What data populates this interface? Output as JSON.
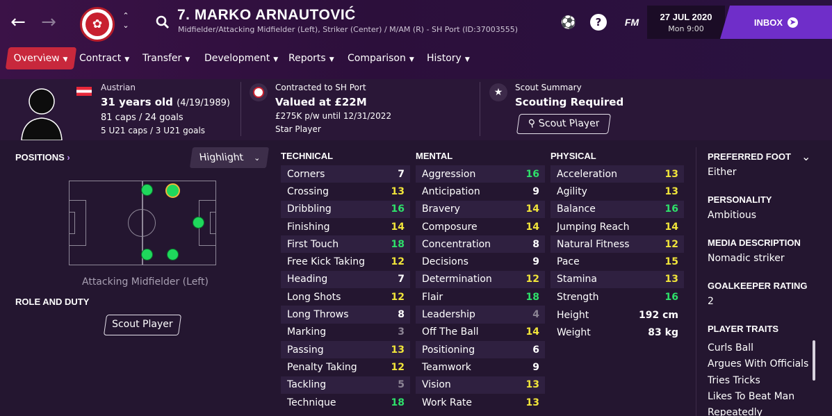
{
  "header": {
    "player_title": "7. MARKO ARNAUTOVIĆ",
    "player_subtitle": "Midfielder/Attacking Midfielder (Left), Striker (Center) / M/AM (R) - SH Port (ID:37003555)",
    "date": "27 JUL 2020",
    "time": "Mon 9:00",
    "inbox_label": "INBOX",
    "fm_label": "FM",
    "help_label": "?"
  },
  "tabs": [
    {
      "label": "Overview"
    },
    {
      "label": "Contract"
    },
    {
      "label": "Transfer"
    },
    {
      "label": "Development"
    },
    {
      "label": "Reports"
    },
    {
      "label": "Comparison"
    },
    {
      "label": "History"
    }
  ],
  "info": {
    "nationality": "Austrian",
    "age": "31 years old",
    "dob": "(4/19/1989)",
    "caps": "81 caps / 24 goals",
    "u21": "5 U21 caps / 3 U21 goals",
    "contract_label": "Contracted to SH Port",
    "value": "Valued at £22M",
    "wage": "£275K p/w until 12/31/2022",
    "status": "Star Player",
    "scout_label": "Scout Summary",
    "scout_status": "Scouting Required",
    "scout_button": "Scout Player"
  },
  "positions": {
    "title": "POSITIONS",
    "highlight": "Highlight",
    "position_name": "Attacking Midfielder (Left)",
    "role_title": "ROLE AND DUTY",
    "role_button": "Scout Player"
  },
  "attributes": {
    "technical_title": "TECHNICAL",
    "mental_title": "MENTAL",
    "physical_title": "PHYSICAL",
    "technical": [
      {
        "name": "Corners",
        "value": "7",
        "tier": "w"
      },
      {
        "name": "Crossing",
        "value": "13",
        "tier": "y"
      },
      {
        "name": "Dribbling",
        "value": "16",
        "tier": "g"
      },
      {
        "name": "Finishing",
        "value": "14",
        "tier": "y"
      },
      {
        "name": "First Touch",
        "value": "18",
        "tier": "g"
      },
      {
        "name": "Free Kick Taking",
        "value": "12",
        "tier": "y"
      },
      {
        "name": "Heading",
        "value": "7",
        "tier": "w"
      },
      {
        "name": "Long Shots",
        "value": "12",
        "tier": "y"
      },
      {
        "name": "Long Throws",
        "value": "8",
        "tier": "w"
      },
      {
        "name": "Marking",
        "value": "3",
        "tier": "d"
      },
      {
        "name": "Passing",
        "value": "13",
        "tier": "y"
      },
      {
        "name": "Penalty Taking",
        "value": "12",
        "tier": "y"
      },
      {
        "name": "Tackling",
        "value": "5",
        "tier": "d"
      },
      {
        "name": "Technique",
        "value": "18",
        "tier": "g"
      }
    ],
    "mental": [
      {
        "name": "Aggression",
        "value": "16",
        "tier": "g"
      },
      {
        "name": "Anticipation",
        "value": "9",
        "tier": "w"
      },
      {
        "name": "Bravery",
        "value": "14",
        "tier": "y"
      },
      {
        "name": "Composure",
        "value": "14",
        "tier": "y"
      },
      {
        "name": "Concentration",
        "value": "8",
        "tier": "w"
      },
      {
        "name": "Decisions",
        "value": "9",
        "tier": "w"
      },
      {
        "name": "Determination",
        "value": "12",
        "tier": "y"
      },
      {
        "name": "Flair",
        "value": "18",
        "tier": "g"
      },
      {
        "name": "Leadership",
        "value": "4",
        "tier": "d"
      },
      {
        "name": "Off The Ball",
        "value": "14",
        "tier": "y"
      },
      {
        "name": "Positioning",
        "value": "6",
        "tier": "w"
      },
      {
        "name": "Teamwork",
        "value": "9",
        "tier": "w"
      },
      {
        "name": "Vision",
        "value": "13",
        "tier": "y"
      },
      {
        "name": "Work Rate",
        "value": "13",
        "tier": "y"
      }
    ],
    "physical": [
      {
        "name": "Acceleration",
        "value": "13",
        "tier": "y"
      },
      {
        "name": "Agility",
        "value": "13",
        "tier": "y"
      },
      {
        "name": "Balance",
        "value": "16",
        "tier": "g"
      },
      {
        "name": "Jumping Reach",
        "value": "14",
        "tier": "y"
      },
      {
        "name": "Natural Fitness",
        "value": "12",
        "tier": "y"
      },
      {
        "name": "Pace",
        "value": "15",
        "tier": "y"
      },
      {
        "name": "Stamina",
        "value": "13",
        "tier": "y"
      },
      {
        "name": "Strength",
        "value": "16",
        "tier": "g"
      }
    ],
    "height_label": "Height",
    "height_value": "192 cm",
    "weight_label": "Weight",
    "weight_value": "83 kg"
  },
  "side": {
    "foot_title": "PREFERRED FOOT",
    "foot_value": "Either",
    "personality_title": "PERSONALITY",
    "personality_value": "Ambitious",
    "media_title": "MEDIA DESCRIPTION",
    "media_value": "Nomadic striker",
    "gk_title": "GOALKEEPER RATING",
    "gk_value": "2",
    "traits_title": "PLAYER TRAITS",
    "traits": [
      "Curls Ball",
      "Argues With Officials",
      "Tries Tricks",
      "Likes To Beat Man Repeatedly"
    ]
  },
  "colors": {
    "accent": "#c8283c",
    "inbox": "#6f2ec9",
    "green": "#2ee06a",
    "yellow": "#f0e43a"
  }
}
